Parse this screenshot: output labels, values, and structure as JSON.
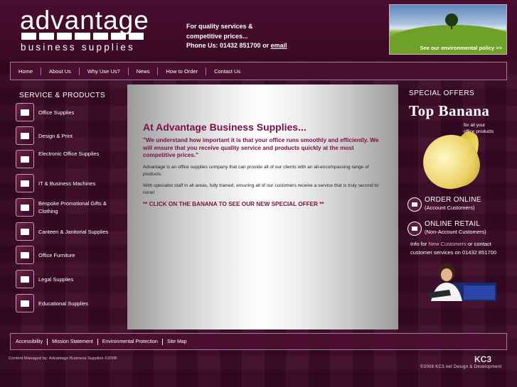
{
  "header": {
    "logo_title": "advantage",
    "logo_subtitle": "business supplies",
    "tagline_line1": "For quality services &",
    "tagline_line2": "competitive prices...",
    "phone_prefix": "Phone Us: 01432 851700 or ",
    "email_link": "email",
    "env_policy_link": "See our environmental policy >>"
  },
  "nav": {
    "items": [
      "Home",
      "About Us",
      "Why Use Us?",
      "News",
      "How to Order",
      "Contact Us"
    ]
  },
  "left": {
    "title": "SERVICE & PRODUCTS",
    "services": [
      {
        "label": "Office Supplies",
        "icon": "envelope-icon"
      },
      {
        "label": "Design & Print",
        "icon": "printer-icon"
      },
      {
        "label": "Electronic Office Supplies",
        "icon": "electronics-icon"
      },
      {
        "label": "IT & Business Machines",
        "icon": "computer-icon"
      },
      {
        "label": "Bespoke Promotional Gifts & Clothing",
        "icon": "gift-icon"
      },
      {
        "label": "Canteen & Janitorial Supplies",
        "icon": "canteen-icon"
      },
      {
        "label": "Office Furniture",
        "icon": "furniture-icon"
      },
      {
        "label": "Legal Supplies",
        "icon": "gavel-icon"
      },
      {
        "label": "Educational Supplies",
        "icon": "bus-icon"
      }
    ]
  },
  "main": {
    "heading": "At Advantage Business Supplies...",
    "quote": "\"We understand how important it is that your office runs smoothly and efficiently. We will ensure that you receive quality service and products quickly at the most competitive prices.\"",
    "para1": "Advantage is an office supplies company that can provide all of our clients with an all-encompassing range of products.",
    "para2": "With specialist staff in all areas, fully trained, ensuring all of our customers receive a service that is truly second to none!",
    "cta": "** CLICK ON THE BANANA TO SEE OUR NEW SPECIAL OFFER **"
  },
  "right": {
    "title": "SPECIAL OFFERS",
    "banana_title": "Top Banana",
    "banana_sub1": "for all your",
    "banana_sub2": "office products",
    "order_online_title": "ORDER ONLINE",
    "order_online_sub": "(Account Customers)",
    "retail_title": "ONLINE RETAIL",
    "retail_sub": "(Non-Account Customers)",
    "info_prefix": "Info for ",
    "info_link": "New Customers",
    "info_suffix": " or contact customer services on ",
    "info_phone": "01432 851700"
  },
  "footer": {
    "links": [
      "Accessibility",
      "Mission Statement",
      "Environmental Protection",
      "Site Map"
    ],
    "credit": "Content Managed by: Advantage Business Supplies ©2008",
    "kc3_logo": "KC3",
    "kc3_credit": "©2008 KC3.net Design & Development"
  },
  "colors": {
    "background": "#3e0a28",
    "accent": "#7a1044"
  }
}
